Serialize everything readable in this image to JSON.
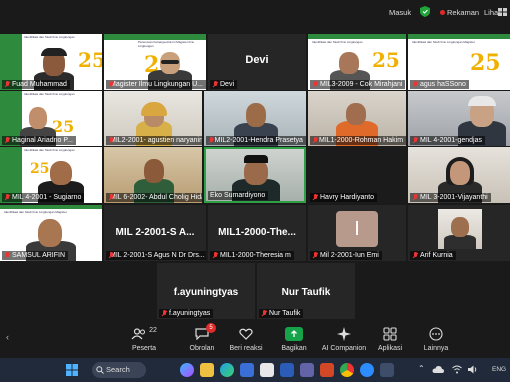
{
  "topbar": {
    "masuk": "Masuk",
    "rekaman": "Rekaman",
    "lihat": "Lihat"
  },
  "tiles": {
    "t1": "Fuad Muhammad",
    "t2": "Magister Ilmu Lingkungan U...",
    "t3": "Devi",
    "t3_big": "Devi",
    "t4": "MIL3-2009 - Cok Mirahjani",
    "t5": "agus haSSono",
    "t6": "Haginal Ariadno P...",
    "t7": "MIL2-2001- agustien naryaning...",
    "t8": "MIL2-2001-Hendra Prasetya",
    "t9": "MIL1-2000-Rohman Hakim",
    "t10": "MIL 4-2001-gendjas",
    "t11": "MIL 4-2001 - Sugiarno",
    "t12": "MIL 6-2002- Abdul Cholig Hida...",
    "t13": "Eko Sumardiyono",
    "t14": "Havry Hardiyanto",
    "t15": "MIL 3-2001-Vijayanthi",
    "t16": "SAMSUL ARIFIN",
    "t17_big": "MIL 2-2001-S A...",
    "t17": "MIL 2-2001-S Agus N Dr Drs...",
    "t18_big": "MIL1-2000-The...",
    "t18": "MIL1-2000-Theresia m",
    "t19": "Mil 2-2001-Iun Emi",
    "t20": "Arif Kurnia",
    "t21_big": "f.ayuningtyas",
    "t21": "f.ayuningtyas",
    "t22_big": "Nur Taufik",
    "t22": "Nur Taufik",
    "avatar_letter": "I"
  },
  "toolbar": {
    "peserta": "Peserta",
    "peserta_count": "22",
    "obrolan": "Obrolan",
    "obrolan_badge": "5",
    "beri_reaksi": "Beri reaksi",
    "bagikan": "Bagikan",
    "ai_companion": "AI Companion",
    "aplikasi": "Aplikasi",
    "lainnya": "Lainnya"
  },
  "taskbar": {
    "search": "Search",
    "lang": "ENG"
  },
  "colors": {
    "accent_green": "#2e8b3e",
    "active_border": "#2ea043",
    "share_green": "#16a34a",
    "record_red": "#e02b2b"
  }
}
